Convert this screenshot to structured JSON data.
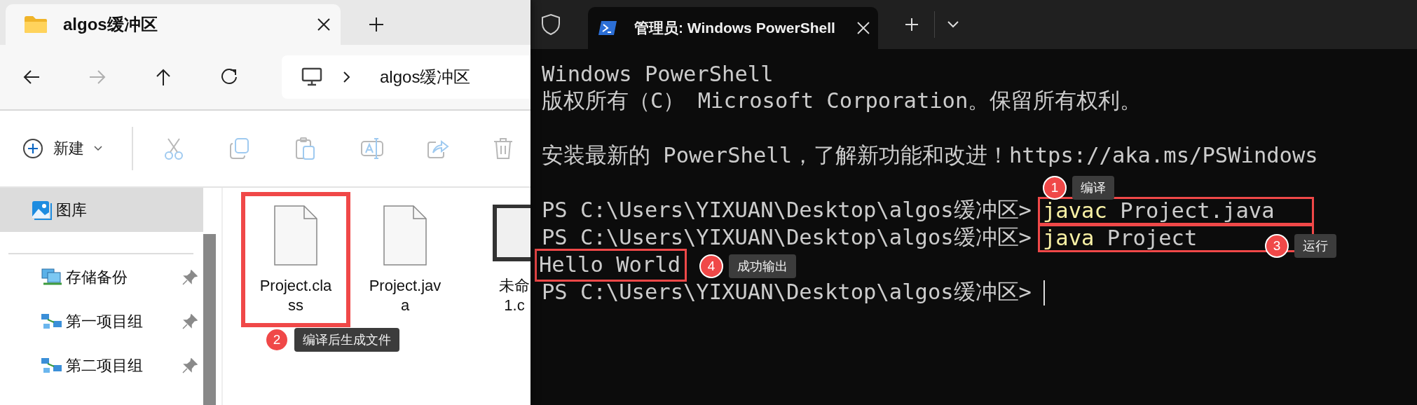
{
  "explorer": {
    "tab": {
      "title": "algos缓冲区",
      "selected": true
    },
    "nav": [
      {
        "kind": "back",
        "disabled": false
      },
      {
        "kind": "forward",
        "disabled": true
      },
      {
        "kind": "up",
        "disabled": false
      },
      {
        "kind": "refresh",
        "disabled": false
      }
    ],
    "address": {
      "crumbs": [
        "algos缓冲区"
      ]
    },
    "toolbar": {
      "new_label": "新建",
      "actions": [
        {
          "kind": "cut",
          "disabled": true
        },
        {
          "kind": "copy",
          "disabled": true
        },
        {
          "kind": "paste",
          "disabled": true
        },
        {
          "kind": "rename",
          "disabled": true
        },
        {
          "kind": "share",
          "disabled": true
        },
        {
          "kind": "delete",
          "disabled": true
        }
      ]
    },
    "sidebar": {
      "items": [
        {
          "label": "图库",
          "kind": "gallery",
          "selected": true,
          "pinned": false
        },
        {
          "label": "存储备份",
          "kind": "monitors",
          "selected": false,
          "pinned": true
        },
        {
          "label": "第一项目组",
          "kind": "network",
          "selected": false,
          "pinned": true
        },
        {
          "label": "第二项目组",
          "kind": "network",
          "selected": false,
          "pinned": true
        }
      ]
    },
    "files": [
      {
        "lines": [
          "Project.cla",
          "ss"
        ],
        "kind": "blank",
        "highlighted": true
      },
      {
        "lines": [
          "Project.jav",
          "a"
        ],
        "kind": "blank",
        "highlighted": false
      },
      {
        "lines": [
          "未命",
          "1.c"
        ],
        "kind": "dark",
        "highlighted": false
      }
    ]
  },
  "terminal": {
    "tab": {
      "title": "管理员: Windows PowerShell",
      "selected": true
    },
    "lines": [
      {
        "kind": "output",
        "text": "Windows PowerShell",
        "highlighted": false
      },
      {
        "kind": "output",
        "text": "版权所有（C） Microsoft Corporation。保留所有权利。",
        "highlighted": false
      },
      {
        "kind": "blank"
      },
      {
        "kind": "output",
        "text": "安装最新的 PowerShell，了解新功能和改进！https://aka.ms/PSWindows",
        "highlighted": false
      },
      {
        "kind": "blank"
      },
      {
        "kind": "prompt",
        "prompt": "PS C:\\Users\\YIXUAN\\Desktop\\algos缓冲区>",
        "command": "javac",
        "args": "Project.java",
        "highlighted": true
      },
      {
        "kind": "prompt",
        "prompt": "PS C:\\Users\\YIXUAN\\Desktop\\algos缓冲区>",
        "command": "java",
        "args": "Project",
        "highlighted": true
      },
      {
        "kind": "output",
        "text": "Hello World",
        "highlighted": true
      },
      {
        "kind": "prompt",
        "prompt": "PS C:\\Users\\YIXUAN\\Desktop\\algos缓冲区>",
        "highlighted": false,
        "cursor": true
      }
    ]
  },
  "annotations": [
    {
      "number": "1",
      "label": "编译"
    },
    {
      "number": "2",
      "label": "编译后生成文件"
    },
    {
      "number": "3",
      "label": "运行"
    },
    {
      "number": "4",
      "label": "成功输出"
    }
  ]
}
